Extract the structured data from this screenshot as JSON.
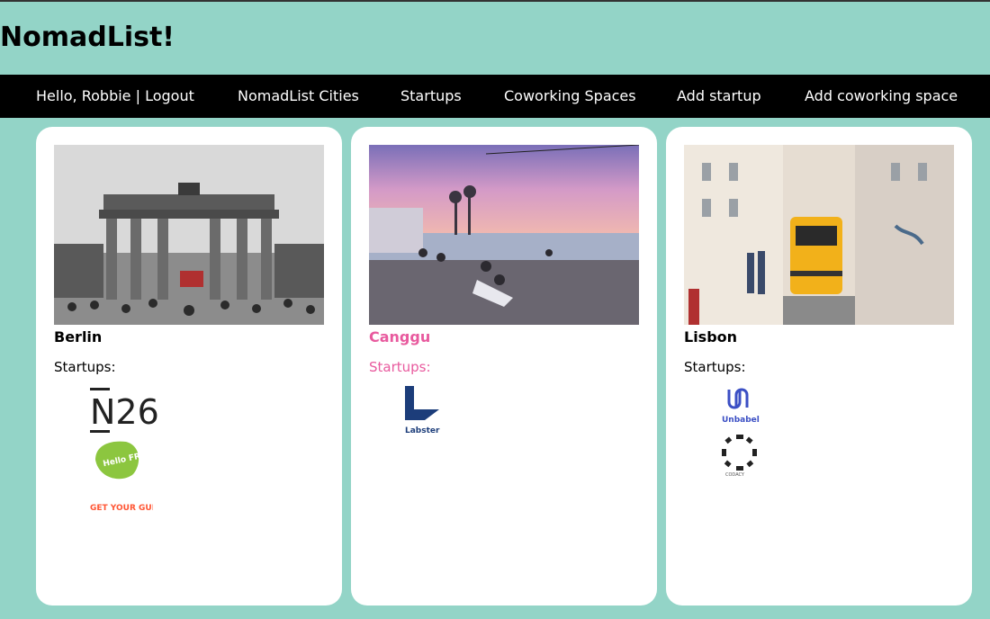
{
  "site": {
    "title": "NomadList!"
  },
  "nav": {
    "user": "Hello, Robbie | Logout",
    "cities": "NomadList Cities",
    "startups": "Startups",
    "coworking": "Coworking Spaces",
    "add_startup": "Add startup",
    "add_coworking": "Add coworking space"
  },
  "cards": [
    {
      "city": "Berlin",
      "startups_label": "Startups:",
      "logos": [
        "N26",
        "Hello FRESH",
        "GET YOUR GUIDE"
      ]
    },
    {
      "city": "Canggu",
      "startups_label": "Startups:",
      "logos": [
        "Labster"
      ]
    },
    {
      "city": "Lisbon",
      "startups_label": "Startups:",
      "logos": [
        "Unbabel",
        "CODACY"
      ]
    }
  ],
  "colors": {
    "background": "#93d4c7",
    "nav": "#000000",
    "active_accent": "#e85a9e"
  }
}
